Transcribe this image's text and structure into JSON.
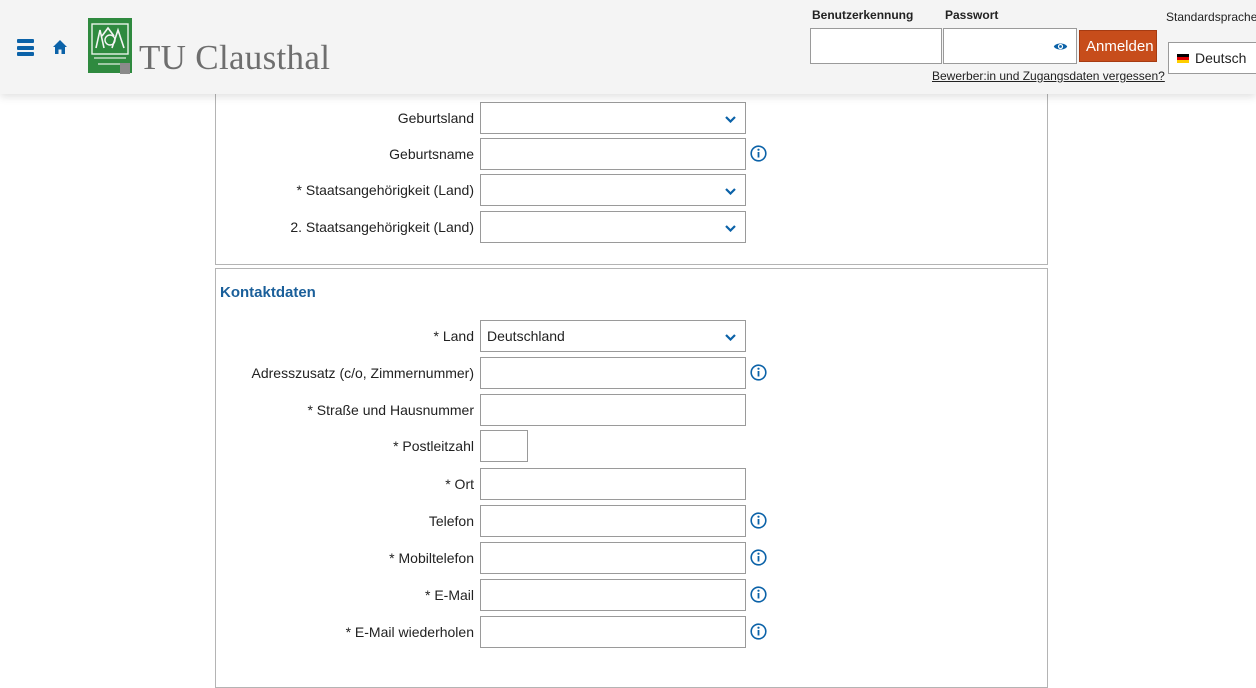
{
  "header": {
    "brand": "TU Clausthal",
    "username_label": "Benutzerkennung",
    "username_value": "",
    "password_label": "Passwort",
    "password_value": "",
    "login_button": "Anmelden",
    "forgot_link": "Bewerber:in und Zugangsdaten vergessen?",
    "language_label": "Standardsprache",
    "language_value": "Deutsch",
    "accent_color": "#c74d1b",
    "link_color": "#0b62a8"
  },
  "personal": {
    "fields": [
      {
        "label": "Geburtsland",
        "value": "",
        "type": "select",
        "info": false
      },
      {
        "label": "Geburtsname",
        "value": "",
        "type": "text",
        "info": true
      },
      {
        "label": "* Staatsangehörigkeit (Land)",
        "value": "",
        "type": "select",
        "info": false
      },
      {
        "label": "2. Staatsangehörigkeit (Land)",
        "value": "",
        "type": "select",
        "info": false
      }
    ]
  },
  "contact": {
    "title": "Kontaktdaten",
    "fields": [
      {
        "label": "* Land",
        "value": "Deutschland",
        "type": "select",
        "info": false
      },
      {
        "label": "Adresszusatz (c/o, Zimmernummer)",
        "value": "",
        "type": "text",
        "info": true
      },
      {
        "label": "* Straße und Hausnummer",
        "value": "",
        "type": "text",
        "info": false
      },
      {
        "label": "* Postleitzahl",
        "value": "",
        "type": "text",
        "info": false
      },
      {
        "label": "* Ort",
        "value": "",
        "type": "text",
        "info": false
      },
      {
        "label": "Telefon",
        "value": "",
        "type": "text",
        "info": true
      },
      {
        "label": "* Mobiltelefon",
        "value": "",
        "type": "text",
        "info": true
      },
      {
        "label": "* E-Mail",
        "value": "",
        "type": "text",
        "info": true
      },
      {
        "label": "* E-Mail wiederholen",
        "value": "",
        "type": "text",
        "info": true
      }
    ]
  },
  "icons": {
    "menu": "hamburger-menu-icon",
    "home": "home-icon",
    "password_toggle": "eye-icon",
    "dropdown": "chevron-down-icon",
    "info": "info-icon",
    "flag": "german-flag-icon"
  }
}
